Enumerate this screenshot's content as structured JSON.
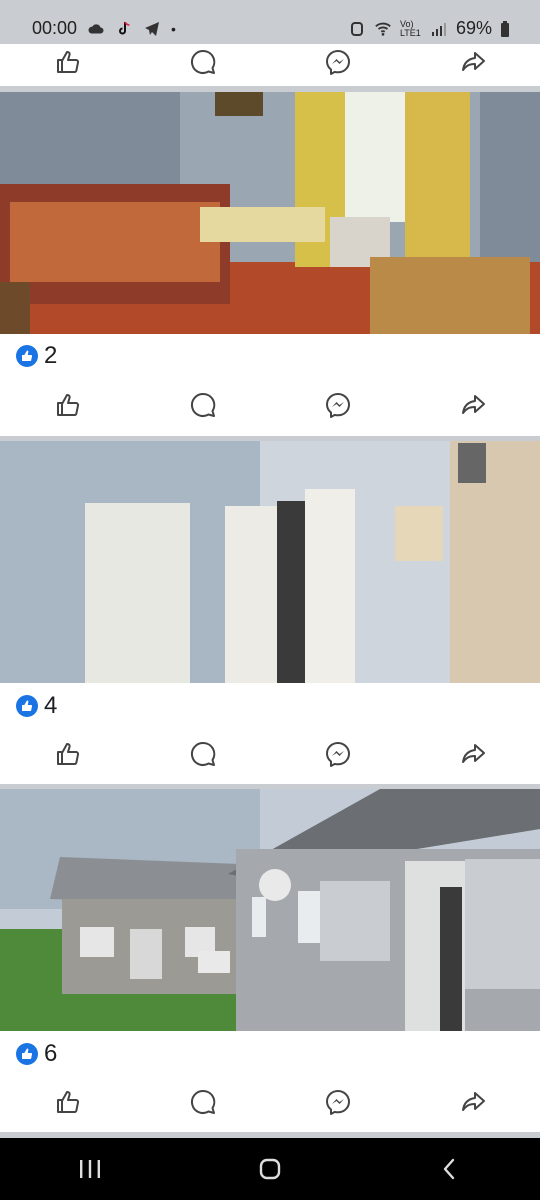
{
  "status": {
    "time": "00:00",
    "battery": "69%",
    "network": "Vo) LTE1"
  },
  "posts": [
    {
      "reactions": "2"
    },
    {
      "reactions": "4"
    },
    {
      "reactions": "6"
    }
  ],
  "colors": {
    "accent": "#1b74e4",
    "divider": "#c9ccd1"
  }
}
